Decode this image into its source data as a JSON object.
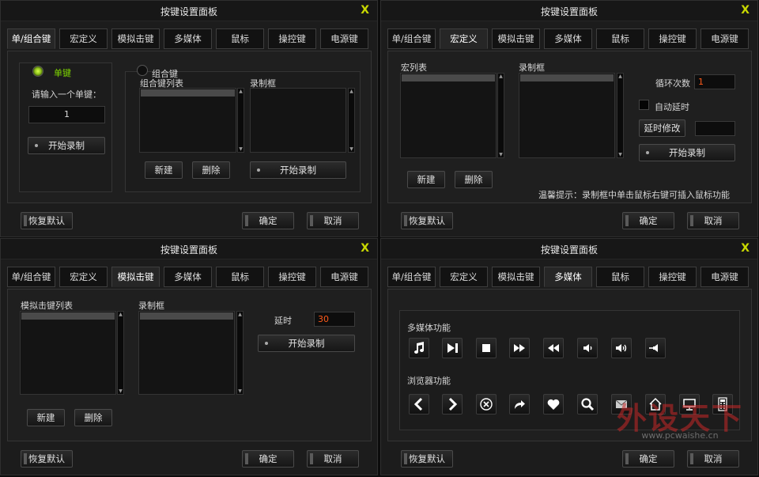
{
  "title": "按键设置面板",
  "close": "X",
  "tabs": [
    "单/组合键",
    "宏定义",
    "模拟击键",
    "多媒体",
    "鼠标",
    "操控键",
    "电源键"
  ],
  "footer": {
    "restore": "恢复默认",
    "ok": "确定",
    "cancel": "取消"
  },
  "p1": {
    "single_label": "单键",
    "prompt": "请输入一个单键：",
    "value": "1",
    "record": "开始录制",
    "combo_label": "组合键",
    "combo_list": "组合键列表",
    "record_box": "录制框",
    "new": "新建",
    "delete": "删除",
    "record2": "开始录制"
  },
  "p2": {
    "macro_list": "宏列表",
    "record_box": "录制框",
    "loop_label": "循环次数",
    "loop_value": "1",
    "auto_delay": "自动延时",
    "delay_edit": "延时修改",
    "record": "开始录制",
    "new": "新建",
    "delete": "删除",
    "hint": "温馨提示：录制框中单击鼠标右键可插入鼠标功能"
  },
  "p3": {
    "keystroke_list": "模拟击键列表",
    "record_box": "录制框",
    "delay_label": "延时",
    "delay_value": "30",
    "record": "开始录制",
    "new": "新建",
    "delete": "删除"
  },
  "p4": {
    "multimedia": "多媒体功能",
    "browser": "浏览器功能",
    "media_icons": [
      "music-icon",
      "play-pause-icon",
      "stop-icon",
      "fast-forward-icon",
      "rewind-icon",
      "volume-down-icon",
      "volume-up-icon",
      "mute-icon"
    ],
    "browser_icons": [
      "back-icon",
      "forward-icon",
      "stop-load-icon",
      "refresh-icon",
      "favorites-icon",
      "search-icon",
      "mail-icon",
      "home-icon",
      "my-computer-icon",
      "calculator-icon"
    ]
  },
  "watermark": {
    "text": "外设天下",
    "url": "www.pcwaishe.cn"
  },
  "colors": {
    "accent": "#8dc01a",
    "title_close": "#c8d800",
    "value_orange": "#ff5a1a"
  }
}
